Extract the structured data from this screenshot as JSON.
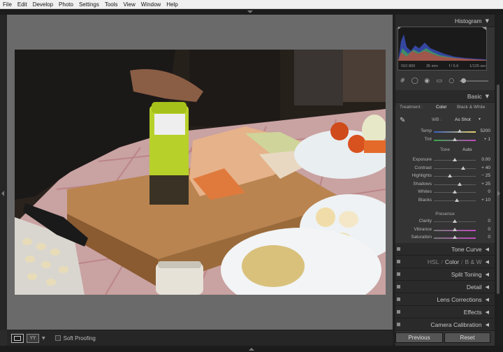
{
  "menubar": {
    "items": [
      "File",
      "Edit",
      "Develop",
      "Photo",
      "Settings",
      "Tools",
      "View",
      "Window",
      "Help"
    ]
  },
  "toolbar": {
    "soft_proofing_label": "Soft Proofing",
    "before_after_label": "YY"
  },
  "histogram": {
    "title": "Histogram",
    "iso": "ISO 800",
    "focal": "35 mm",
    "aperture": "f / 5.6",
    "shutter": "1/125 sec"
  },
  "basic": {
    "title": "Basic",
    "treatment_label": "Treatment :",
    "treatment_color": "Color",
    "treatment_bw": "Black & White",
    "wb_label": "WB :",
    "wb_value": "As Shot",
    "tone_label": "Tone",
    "auto_label": "Auto",
    "presence_label": "Presence",
    "sliders": [
      {
        "label": "Temp",
        "value": "5200",
        "pos": 0.62
      },
      {
        "label": "Tint",
        "value": "+ 1",
        "pos": 0.5
      },
      {
        "label": "Exposure",
        "value": "0.00",
        "pos": 0.5
      },
      {
        "label": "Contrast",
        "value": "+ 40",
        "pos": 0.7
      },
      {
        "label": "Highlights",
        "value": "− 25",
        "pos": 0.38
      },
      {
        "label": "Shadows",
        "value": "+ 25",
        "pos": 0.62
      },
      {
        "label": "Whites",
        "value": "0",
        "pos": 0.5
      },
      {
        "label": "Blacks",
        "value": "+ 10",
        "pos": 0.55
      },
      {
        "label": "Clarity",
        "value": "0",
        "pos": 0.5
      },
      {
        "label": "Vibrance",
        "value": "0",
        "pos": 0.5
      },
      {
        "label": "Saturation",
        "value": "0",
        "pos": 0.5
      }
    ]
  },
  "panels": {
    "tone_curve": "Tone Curve",
    "hsl": "HSL",
    "color": "Color",
    "bw": "B & W",
    "split_toning": "Split Toning",
    "detail": "Detail",
    "lens_corrections": "Lens Corrections",
    "effects": "Effects",
    "camera_calibration": "Camera Calibration"
  },
  "buttons": {
    "previous": "Previous",
    "reset": "Reset"
  }
}
